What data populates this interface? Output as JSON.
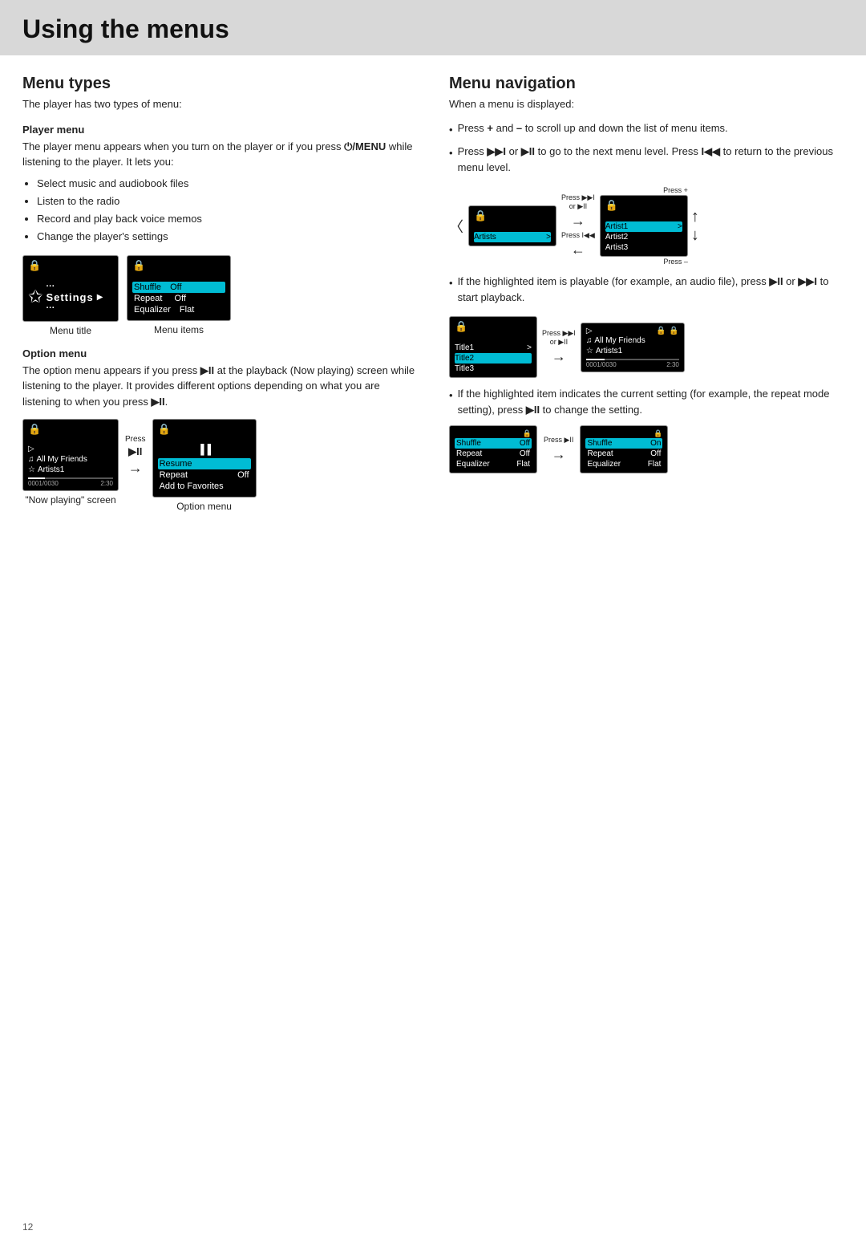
{
  "page": {
    "title": "Using the menus",
    "page_number": "12"
  },
  "left": {
    "section_title": "Menu types",
    "section_desc": "The player has two types of menu:",
    "player_menu": {
      "label": "Player menu",
      "desc1": "The player menu appears when you turn on the player or if you press ",
      "button_symbol": "⏻/MENU",
      "desc2": " while listening to the player. It lets you:",
      "items": [
        "Select music and audiobook files",
        "Listen to the radio",
        "Record and play back voice memos",
        "Change the player's settings"
      ]
    },
    "settings_screen": {
      "title": "Settings",
      "dots_before": "···",
      "dots_after": "···"
    },
    "menu_items_screen": {
      "rows": [
        {
          "label": "Shuffle",
          "value": "Off",
          "highlighted": true
        },
        {
          "label": "Repeat",
          "value": "Off",
          "highlighted": false
        },
        {
          "label": "Equalizer",
          "value": "Flat",
          "highlighted": false
        }
      ]
    },
    "menu_title_label": "Menu title",
    "menu_items_label": "Menu items",
    "option_menu": {
      "label": "Option menu",
      "desc": "The option menu appears if you press ▶II at the playback (Now playing) screen while listening to the player. It provides different options depending on what you are listening to when you press ▶II."
    },
    "now_playing_screen": {
      "top_icon": "▷",
      "row1": "♫ All My Friends",
      "row2": "☆ Artists1",
      "time_start": "0001/0030",
      "time_end": "2:30"
    },
    "press_label": "Press",
    "press_symbol": "▶II",
    "option_menu_screen": {
      "top_icon": "||",
      "rows": [
        {
          "label": "Resume",
          "highlighted": true
        },
        {
          "label": "Repeat",
          "value": "Off",
          "highlighted": false
        },
        {
          "label": "Add to Favorites",
          "highlighted": false
        }
      ]
    },
    "now_playing_screen_label": "\"Now playing\" screen",
    "option_menu_label": "Option menu"
  },
  "right": {
    "section_title": "Menu navigation",
    "section_desc": "When a menu is displayed:",
    "bullets": [
      "Press + and – to scroll up and down the list of menu items.",
      "Press ▶▶I or ▶II to go to the next menu level. Press I◀◀ to return to the previous menu level.",
      "If the highlighted item is playable (for example, an audio file), press ▶II or ▶▶I to start playback.",
      "If the highlighted item indicates the current setting (for example, the repeat mode setting), press ▶II to change the setting."
    ],
    "nav_diagram_1": {
      "screen1": {
        "lock": "🔒",
        "rows": [
          {
            "label": "Artists",
            "arrow": ">",
            "highlighted": true
          }
        ]
      },
      "press_label1": "Press ▶▶I",
      "press_label1b": "or ▶II",
      "press_back_label": "Press I◀◀",
      "screen2": {
        "lock": "🔒",
        "rows": [
          {
            "label": "Artist1",
            "arrow": ">",
            "highlighted": false
          },
          {
            "label": "Artist2",
            "arrow": "",
            "highlighted": false
          },
          {
            "label": "Artist3",
            "arrow": "",
            "highlighted": false
          }
        ]
      },
      "press_plus": "Press +",
      "press_minus": "Press –"
    },
    "nav_diagram_2": {
      "screen1": {
        "lock": "🔒",
        "rows": [
          {
            "label": "Title1",
            "arrow": ">",
            "highlighted": false
          },
          {
            "label": "Title2",
            "arrow": "",
            "highlighted": true
          },
          {
            "label": "Title3",
            "arrow": "",
            "highlighted": false
          }
        ]
      },
      "press_label": "Press ▶▶I",
      "press_label2": "or ▶II",
      "screen2": {
        "top": "▷",
        "lock": "🔒",
        "row1": "♫ All My Friends",
        "row2": "☆ Artists1",
        "time_start": "0001/0030",
        "time_end": "2:30"
      }
    },
    "eq_diagram": {
      "screen1": {
        "lock": "🔒",
        "rows": [
          {
            "label": "Shuffle",
            "value": "Off",
            "highlighted": true
          },
          {
            "label": "Repeat",
            "value": "Off",
            "highlighted": false
          },
          {
            "label": "Equalizer",
            "value": "Flat",
            "highlighted": false
          }
        ]
      },
      "press_label": "Press ▶II",
      "screen2": {
        "lock": "🔒",
        "rows": [
          {
            "label": "Shuffle",
            "value": "On",
            "highlighted": true
          },
          {
            "label": "Repeat",
            "value": "Off",
            "highlighted": false
          },
          {
            "label": "Equalizer",
            "value": "Flat",
            "highlighted": false
          }
        ]
      }
    }
  }
}
